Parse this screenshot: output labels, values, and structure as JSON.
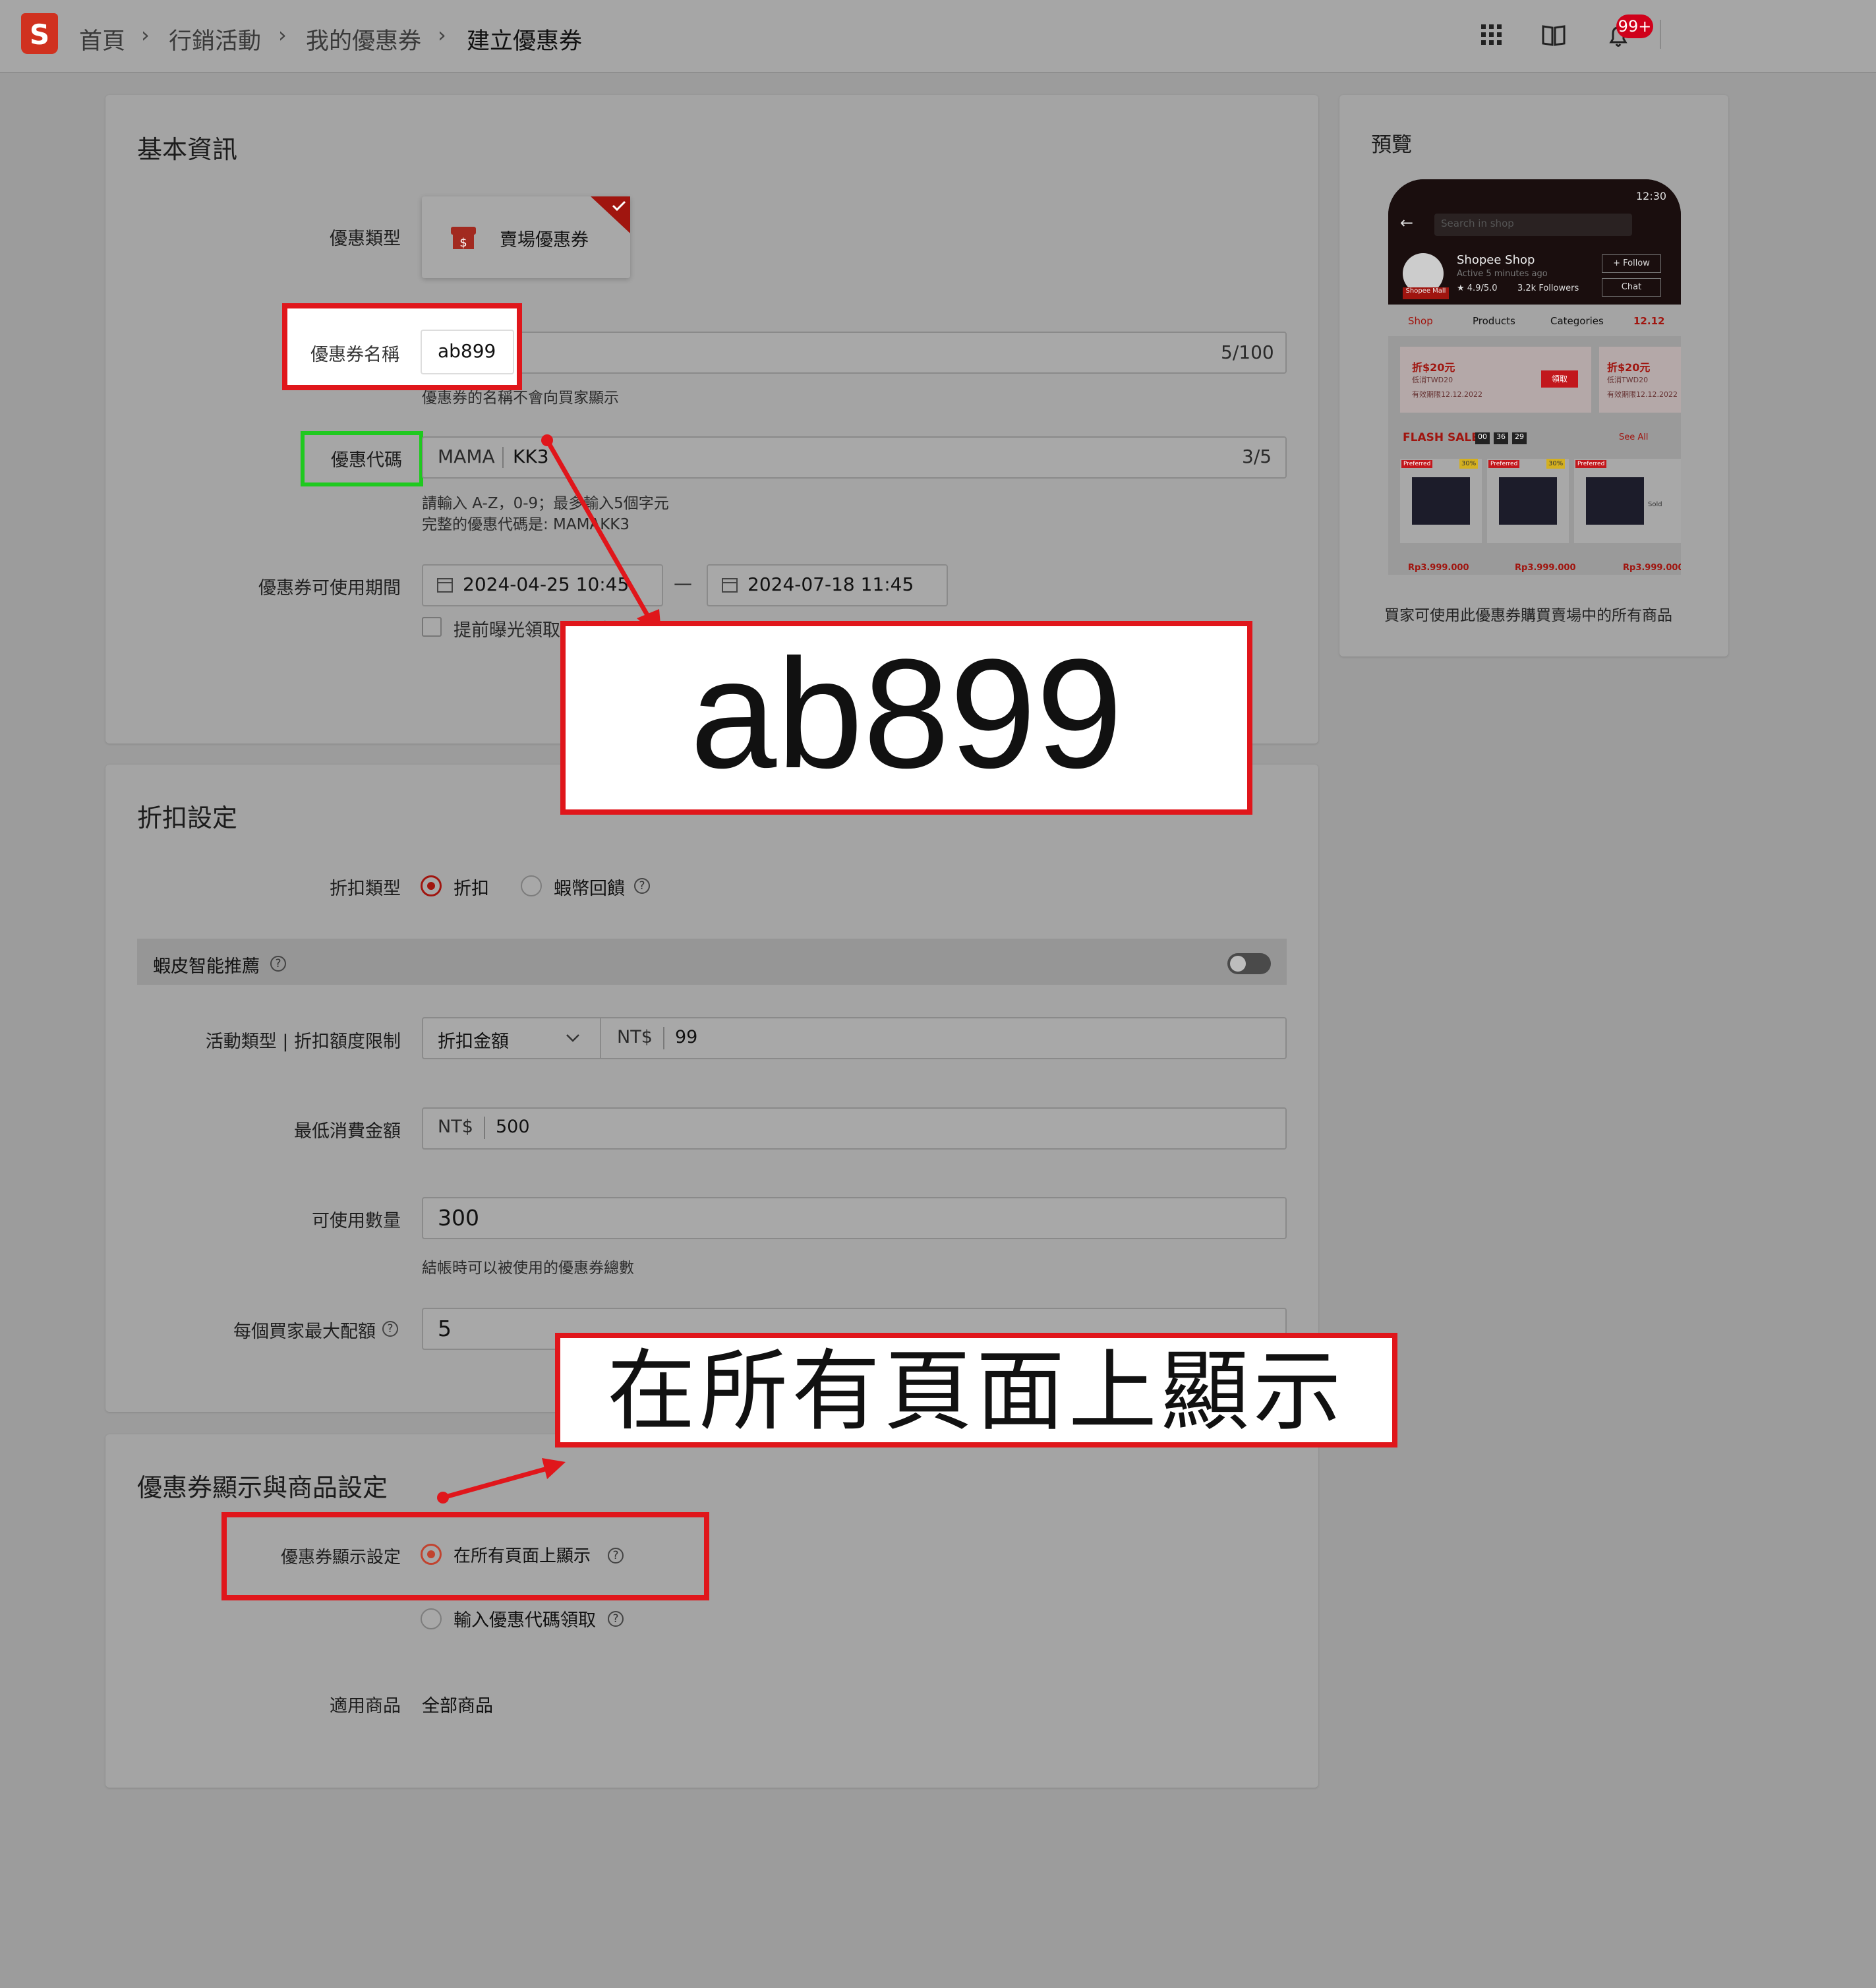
{
  "breadcrumb": [
    "首頁",
    "行銷活動",
    "我的優惠券",
    "建立優惠券"
  ],
  "header": {
    "notification_badge": "99+"
  },
  "basic": {
    "title": "基本資訊",
    "type_label": "優惠類型",
    "type_option": "賣場優惠券",
    "name_label": "優惠券名稱",
    "name_value": "ab899",
    "name_count": "5/100",
    "name_hint": "優惠券的名稱不會向買家顯示",
    "code_label": "優惠代碼",
    "code_prefix": "MAMA",
    "code_value": "KK3",
    "code_count": "3/5",
    "code_hint1": "請輸入 A-Z，0-9；最多輸入5個字元",
    "code_hint2": "完整的優惠代碼是: MAMAKK3",
    "period_label": "優惠券可使用期間",
    "start": "2024-04-25 10:45",
    "end": "2024-07-18 11:45",
    "dash": "—",
    "early_label": "提前曝光領取優惠券"
  },
  "discount": {
    "title": "折扣設定",
    "type_label": "折扣類型",
    "opt_discount": "折扣",
    "opt_coins": "蝦幣回饋",
    "smart_label": "蝦皮智能推薦",
    "activity_label": "活動類型 | 折扣額度限制",
    "activity_select": "折扣金額",
    "currency": "NT$",
    "amount": "99",
    "min_label": "最低消費金額",
    "min_value": "500",
    "qty_label": "可使用數量",
    "qty_value": "300",
    "qty_hint": "結帳時可以被使用的優惠券總數",
    "max_label": "每個買家最大配額",
    "max_value": "5"
  },
  "display": {
    "title": "優惠券顯示與商品設定",
    "label": "優惠券顯示設定",
    "opt_all": "在所有頁面上顯示",
    "opt_code": "輸入優惠代碼領取",
    "products_label": "適用商品",
    "products_value": "全部商品"
  },
  "preview": {
    "title": "預覽",
    "caption": "買家可使用此優惠券購買賣場中的所有商品",
    "search": "Search in shop",
    "shop": "Shopee Shop",
    "active": "Active 5 minutes ago",
    "rating": "★ 4.9/5.0",
    "followers": "3.2k Followers",
    "follow": "+ Follow",
    "chat": "Chat",
    "tabs": [
      "Shop",
      "Products",
      "Categories",
      "12.12"
    ],
    "voucher": "折$20元",
    "voucher_sub": "低消TWD20",
    "voucher_exp": "有效期限12.12.2022",
    "claim": "領取",
    "flash": "FLASH SALE",
    "timer": [
      "00",
      "36",
      "29"
    ],
    "see_all": "See All",
    "price": "Rp3.999.000",
    "time": "12:30",
    "mall": "Shopee Mall",
    "preferred": "Preferred",
    "discount_tag": "30%",
    "sold": "Sold"
  },
  "annotations": {
    "big_name": "ab899",
    "big_display": "在所有頁面上顯示"
  },
  "colors": {
    "highlight_red": "#e0161b",
    "highlight_green": "#1fc91f",
    "brand": "#d0311f"
  }
}
